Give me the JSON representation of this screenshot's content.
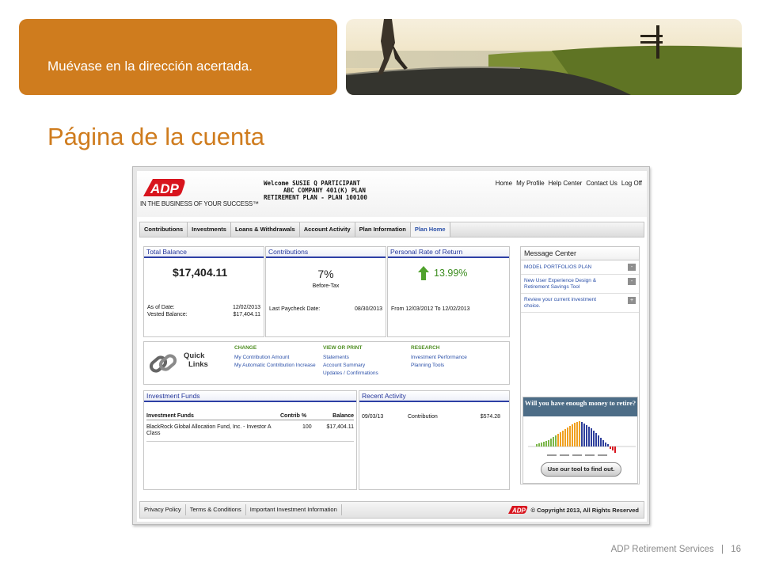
{
  "slide": {
    "banner_text": "Muévase en la dirección acertada.",
    "page_title": "Página de la cuenta",
    "footer_company": "ADP Retirement Services",
    "footer_separator": "|",
    "page_number": "16"
  },
  "colors": {
    "accent": "#cf7c1e",
    "link_blue": "#2a4fa8",
    "header_blue": "#2d3fa5",
    "logo_red": "#d8141d"
  },
  "app": {
    "logo_text": "ADP",
    "tagline": "IN THE BUSINESS OF YOUR SUCCESS™",
    "welcome_line1": "Welcome SUSIE Q PARTICIPANT",
    "welcome_line2": "ABC COMPANY 401(K) PLAN",
    "welcome_line3": "RETIREMENT PLAN - PLAN 100100",
    "top_nav": [
      "Home",
      "My Profile",
      "Help Center",
      "Contact Us",
      "Log Off"
    ],
    "tabs": [
      "Contributions",
      "Investments",
      "Loans & Withdrawals",
      "Account Activity",
      "Plan Information",
      "Plan Home"
    ],
    "active_tab": "Plan Home"
  },
  "total_balance": {
    "title": "Total Balance",
    "amount": "$17,404.11",
    "as_of_label": "As of Date:",
    "as_of_value": "12/02/2013",
    "vested_label": "Vested Balance:",
    "vested_value": "$17,404.11"
  },
  "contributions": {
    "title": "Contributions",
    "percent": "7%",
    "type": "Before-Tax",
    "last_paycheck_label": "Last Paycheck Date:",
    "last_paycheck_value": "08/30/2013"
  },
  "rate_of_return": {
    "title": "Personal Rate of Return",
    "value": "13.99%",
    "period": "From 12/03/2012 To 12/02/2013"
  },
  "message_center": {
    "title": "Message Center",
    "items": [
      {
        "text": "MODEL PORTFOLIOS PLAN",
        "action": "-"
      },
      {
        "text": "New User Experience Design & Retirement Savings Tool",
        "action": "-"
      },
      {
        "text": "Review your current investment choice.",
        "action": "+"
      }
    ]
  },
  "quick_links": {
    "title_line1": "Quick",
    "title_line2": "Links",
    "change": {
      "heading": "CHANGE",
      "links": [
        "My Contribution Amount",
        "My Automatic Contribution Increase"
      ]
    },
    "view": {
      "heading": "VIEW OR PRINT",
      "links": [
        "Statements",
        "Account Summary",
        "Updates / Confirmations"
      ]
    },
    "research": {
      "heading": "RESEARCH",
      "links": [
        "Investment Performance",
        "Planning Tools"
      ]
    }
  },
  "investment_funds": {
    "title": "Investment Funds",
    "columns": [
      "Investment Funds",
      "Contrib %",
      "Balance"
    ],
    "rows": [
      {
        "fund": "BlackRock Global Allocation Fund, Inc. - Investor A Class",
        "contrib": "100",
        "balance": "$17,404.11"
      }
    ]
  },
  "recent_activity": {
    "title": "Recent Activity",
    "rows": [
      {
        "date": "09/03/13",
        "type": "Contribution",
        "amount": "$574.28"
      }
    ]
  },
  "promo": {
    "headline": "Will you have enough money to retire?",
    "button": "Use our tool to find out."
  },
  "footer": {
    "links": [
      "Privacy Policy",
      "Terms & Conditions",
      "Important Investment Information"
    ],
    "copyright": "© Copyright 2013, All Rights Reserved"
  }
}
